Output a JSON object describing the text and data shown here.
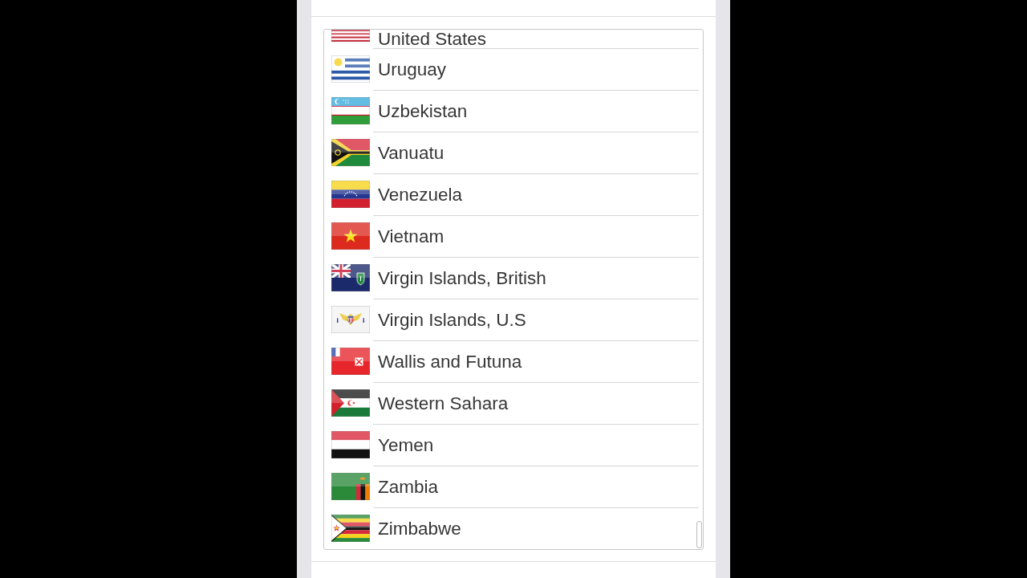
{
  "country_list": {
    "items": [
      {
        "name": "United States"
      },
      {
        "name": "Uruguay"
      },
      {
        "name": "Uzbekistan"
      },
      {
        "name": "Vanuatu"
      },
      {
        "name": "Venezuela"
      },
      {
        "name": "Vietnam"
      },
      {
        "name": "Virgin Islands, British"
      },
      {
        "name": "Virgin Islands, U.S"
      },
      {
        "name": "Wallis and Futuna"
      },
      {
        "name": "Western Sahara"
      },
      {
        "name": "Yemen"
      },
      {
        "name": "Zambia"
      },
      {
        "name": "Zimbabwe"
      }
    ]
  }
}
